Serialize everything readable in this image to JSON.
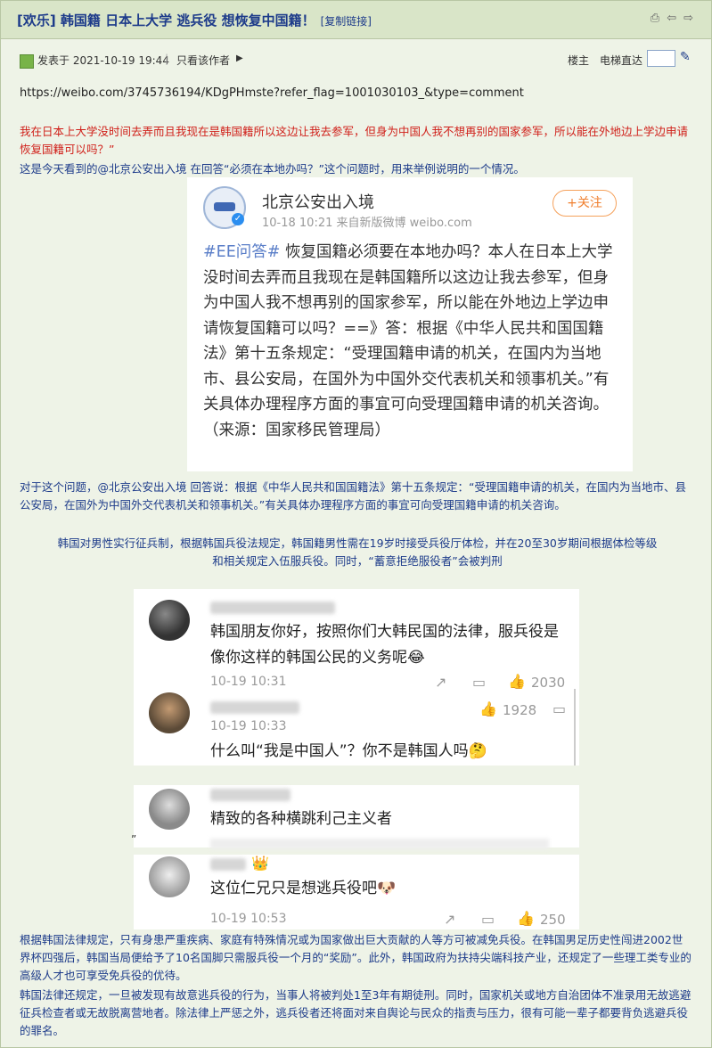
{
  "header": {
    "title": "[欢乐] 韩国籍 日本上大学 逃兵役 想恢复中国籍！",
    "copy_link": "[复制链接]"
  },
  "meta": {
    "posted": "发表于 2021-10-19 19:44",
    "author_only": "只看该作者",
    "floor": "楼主",
    "elevator": "电梯直达"
  },
  "post": {
    "url": "https://weibo.com/3745736194/KDgPHmste?refer_flag=1001030103_&type=comment",
    "red_quote": "我在日本上大学没时间去弄而且我现在是韩国籍所以这边让我去参军，但身为中国人我不想再别的国家参军，所以能在外地边上学边申请恢复国籍可以吗？”",
    "intro": "这是今天看到的@北京公安出入境 在回答“必须在本地办吗？”这个问题时，用来举例说明的一个情况。",
    "after_card": "对于这个问题，@北京公安出入境 回答说：根据《中华人民共和国国籍法》第十五条规定：“受理国籍申请的机关，在国内为当地市、县公安局，在国外为中国外交代表机关和领事机关。”有关具体办理程序方面的事宜可向受理国籍申请的机关咨询。",
    "military": "韩国对男性实行征兵制，根据韩国兵役法规定，韩国籍男性需在19岁时接受兵役厅体检，并在20至30岁期间根据体检等级和相关规定入伍服兵役。同时，“蓄意拒绝服役者”会被判刑",
    "quote_mark": "”",
    "law1": "根据韩国法律规定，只有身患严重疾病、家庭有特殊情况或为国家做出巨大贡献的人等方可被减免兵役。在韩国男足历史性闯进2002世界杯四强后，韩国当局便给予了10名国脚只需服兵役一个月的“奖励”。此外，韩国政府为扶持尖端科技产业，还规定了一些理工类专业的高级人才也可享受免兵役的优待。",
    "law2": "韩国法律还规定，一旦被发现有故意逃兵役的行为，当事人将被判处1至3年有期徒刑。同时，国家机关或地方自治团体不准录用无故逃避征兵检查者或无故脱离营地者。除法律上严惩之外，逃兵役者还将面对来自舆论与民众的指责与压力，很有可能一辈子都要背负逃避兵役的罪名。"
  },
  "weibo_card": {
    "name": "北京公安出入境",
    "meta": "10-18 10:21  来自新版微博 weibo.com",
    "follow": "+关注",
    "tag": "#EE问答#",
    "body": " 恢复国籍必须要在本地办吗？本人在日本上大学没时间去弄而且我现在是韩国籍所以这边让我去参军，但身为中国人我不想再别的国家参军，所以能在外地边上学边申请恢复国籍可以吗？==》答：根据《中华人民共和国国籍法》第十五条规定：“受理国籍申请的机关，在国内为当地市、县公安局，在国外为中国外交代表机关和领事机关。”有关具体办理程序方面的事宜可向受理国籍申请的机关咨询。（来源：国家移民管理局）"
  },
  "comments": [
    {
      "text": "韩国朋友你好，按照你们大韩民国的法律，服兵役是像你这样的韩国公民的义务呢😂",
      "time": "10-19 10:31",
      "likes": "2030"
    },
    {
      "text": "什么叫“我是中国人”？你不是韩国人吗🤔",
      "time": "10-19 10:33",
      "likes": "1928"
    },
    {
      "text": "精致的各种横跳利己主义者"
    },
    {
      "text": "这位仁兄只是想逃兵役吧🐶",
      "time": "10-19 10:53",
      "likes": "250"
    }
  ]
}
